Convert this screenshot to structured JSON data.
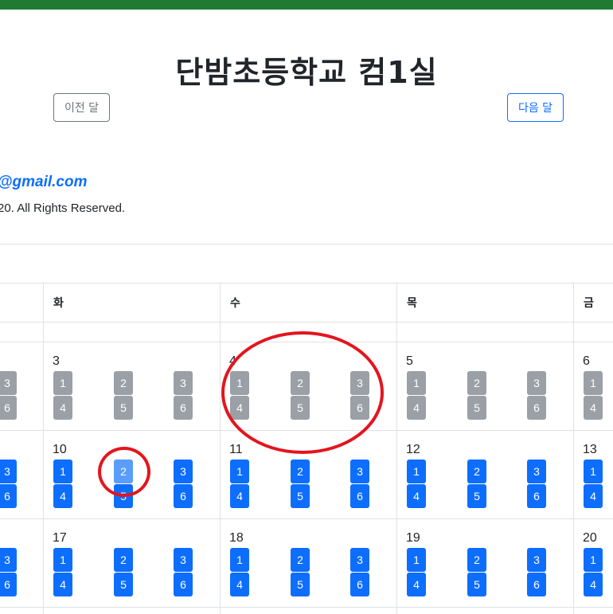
{
  "header": {
    "title": "단밤초등학교 컴1실",
    "prev_label": "이전 달",
    "next_label": "다음 달"
  },
  "footer": {
    "email": "@gmail.com",
    "copyright": "20. All Rights Reserved."
  },
  "calendar": {
    "day_headers": [
      "화",
      "수",
      "목",
      "금"
    ],
    "weeks": [
      {
        "dates": [
          "3",
          "4",
          "5",
          "6"
        ],
        "status": "past"
      },
      {
        "dates": [
          "10",
          "11",
          "12",
          "13"
        ],
        "status": "available"
      },
      {
        "dates": [
          "17",
          "18",
          "19",
          "20"
        ],
        "status": "available"
      }
    ],
    "slot_rows": [
      [
        "1",
        "2",
        "3"
      ],
      [
        "4",
        "5",
        "6"
      ]
    ],
    "left_partial_slots": [
      "3",
      "6"
    ],
    "right_partial_slots": [
      "1",
      "4"
    ],
    "highlighted_slot": {
      "week": 1,
      "day": 0,
      "period": "2"
    }
  },
  "colors": {
    "header_bar": "#1f7a32",
    "available_slot": "#0d6efd",
    "past_slot": "#9aa0a6",
    "annotation": "#e3151f"
  }
}
